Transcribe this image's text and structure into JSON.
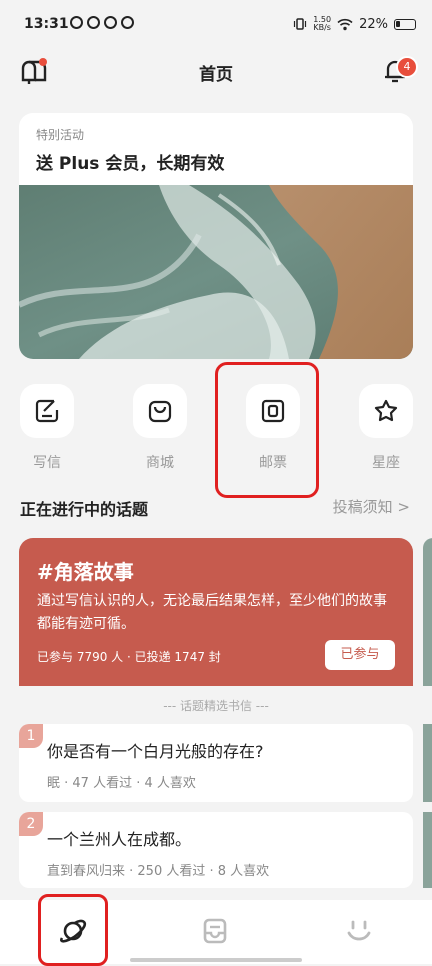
{
  "status_bar": {
    "time": "13:31",
    "net_speed_value": "1.50",
    "net_speed_unit": "KB/s",
    "battery": "22%"
  },
  "header": {
    "title": "首页",
    "notification_count": "4"
  },
  "banner": {
    "tag": "特别活动",
    "headline": "送 Plus 会员，长期有效"
  },
  "quick_entries": [
    {
      "label": "写信",
      "icon": "write-letter-icon"
    },
    {
      "label": "商城",
      "icon": "shop-bag-icon"
    },
    {
      "label": "邮票",
      "icon": "stamp-icon"
    },
    {
      "label": "星座",
      "icon": "star-icon"
    }
  ],
  "section": {
    "title": "正在进行中的话题",
    "guideline_link": "投稿须知 >"
  },
  "topic": {
    "title": "#角落故事",
    "description": "通过写信认识的人，无论最后结果怎样，至少他们的故事都能有迹可循。",
    "stats": "已参与 7790 人 · 已投递 1747 封",
    "button": "已参与"
  },
  "picked_label": "---  话题精选书信  ---",
  "letters": [
    {
      "num": "1",
      "title": "你是否有一个白月光般的存在?",
      "meta": "眠 · 47 人看过 · 4 人喜欢"
    },
    {
      "num": "2",
      "title": "一个兰州人在成都。",
      "meta": "直到春风归来 · 250 人看过 · 8 人喜欢"
    }
  ],
  "colors": {
    "topic_bg": "#c65b4e",
    "accent_red": "#e84e3c",
    "side_green": "#8aa39a"
  }
}
